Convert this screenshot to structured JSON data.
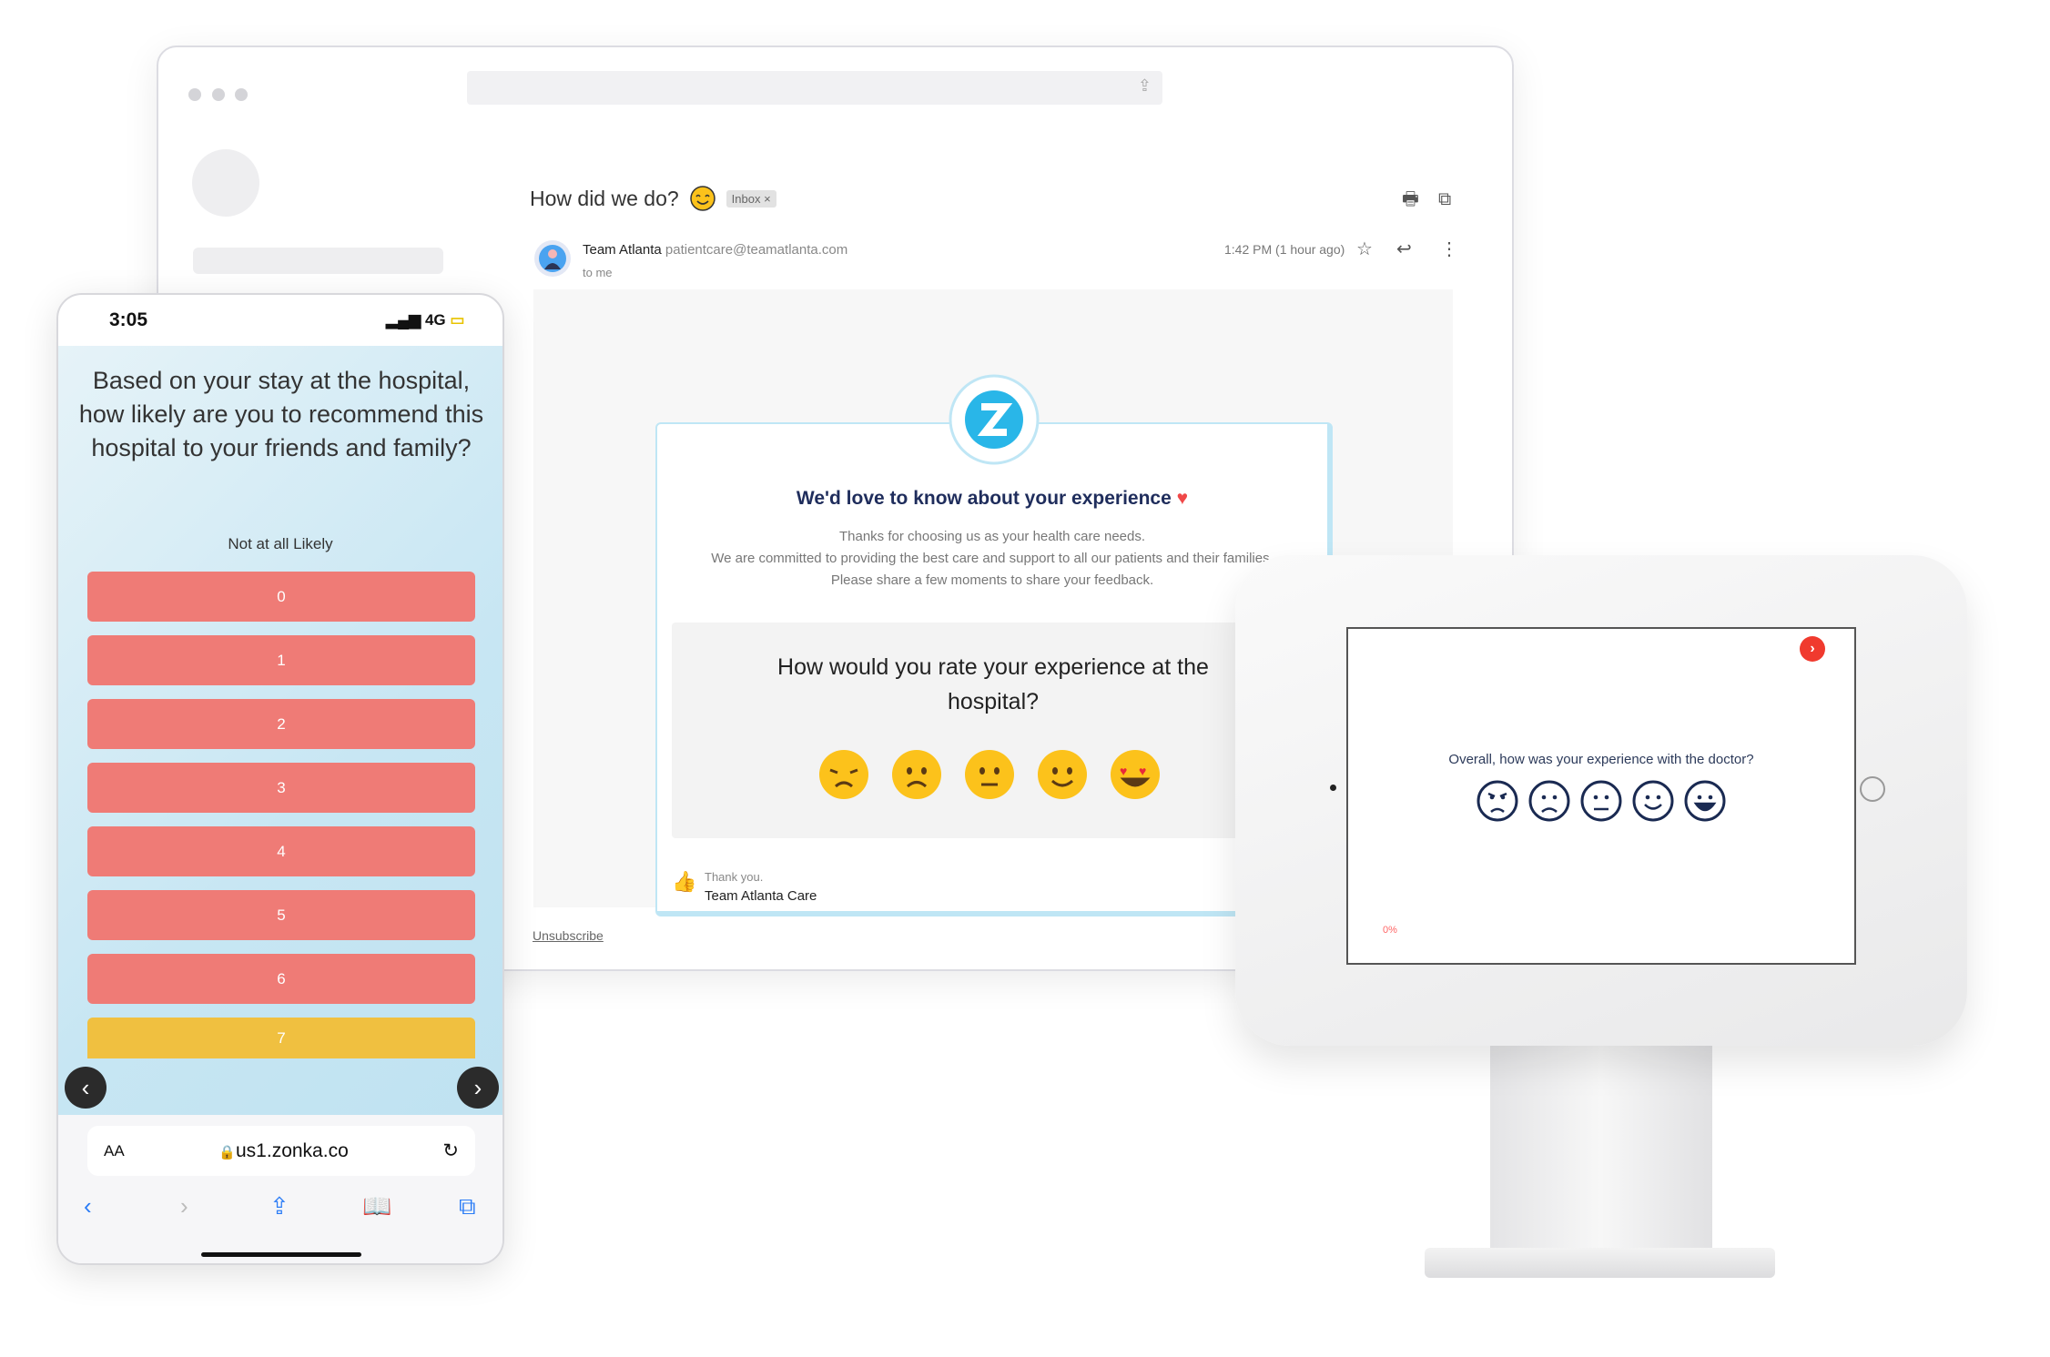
{
  "email": {
    "subject": "How did we do?",
    "badge": "Inbox ×",
    "sender_name": "Team Atlanta",
    "sender_email": "patientcare@teamatlanta.com",
    "recipient": "to me",
    "timestamp": "1:42 PM (1 hour ago)",
    "card_title": "We'd love to know about your experience",
    "card_lines": [
      "Thanks for choosing us as your health care needs.",
      "We are committed to providing the best care and support to all our patients and their families.",
      "Please share a few moments to share your feedback."
    ],
    "question": "How would you rate your experience at the hospital?",
    "emoji_options": [
      "weary",
      "frowning",
      "neutral",
      "slightly-smiling",
      "heart-eyes"
    ],
    "signoff": "Thank you.",
    "signature": "Team Atlanta Care",
    "unsubscribe": "Unsubscribe"
  },
  "phone": {
    "time": "3:05",
    "network": "4G",
    "question": "Based on your stay at the hospital, how likely are you to recommend this hospital to your friends and family?",
    "scale_label": "Not at all Likely",
    "options": [
      "0",
      "1",
      "2",
      "3",
      "4",
      "5",
      "6",
      "7"
    ],
    "url_aa": "AA",
    "url": "us1.zonka.co"
  },
  "kiosk": {
    "question": "Overall, how was your experience with the doctor?",
    "faces": [
      "angry",
      "sad",
      "neutral",
      "happy",
      "very-happy"
    ],
    "progress": "0%"
  },
  "colors": {
    "option_red": "#ef7b76",
    "option_selected": "#f0c040",
    "kiosk_accent": "#f03a2e",
    "brand_blue": "#29b6e8",
    "navy": "#1f2d5c"
  }
}
